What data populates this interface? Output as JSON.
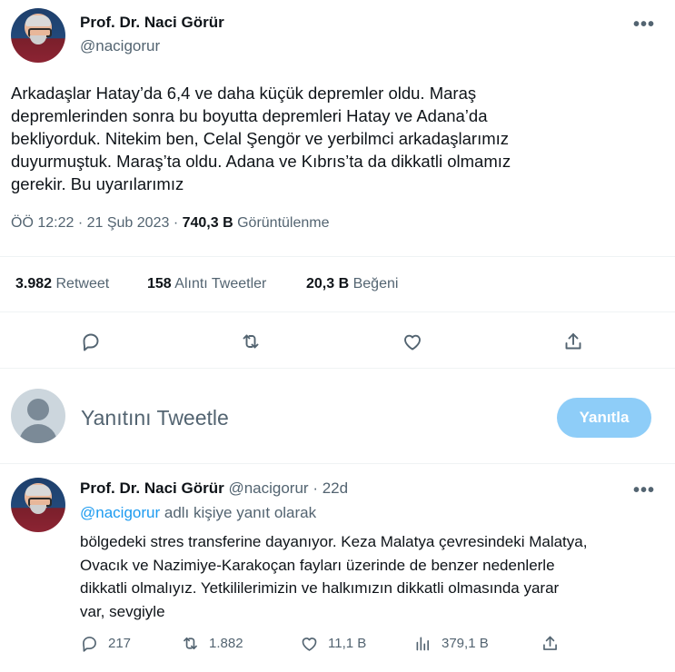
{
  "tweet": {
    "author_name": "Prof. Dr. Naci Görür",
    "author_handle": "@nacigorur",
    "more_label": "•••",
    "text_lines": [
      "Arkadaşlar Hatay’da 6,4 ve daha küçük depremler oldu. Maraş",
      "depremlerinden sonra bu boyutta depremleri Hatay ve Adana’da",
      "bekliyorduk. Nitekim ben, Celal Şengör ve yerbilmci arkadaşlarımız",
      "duyurmuştuk. Maraş’ta oldu. Adana ve Kıbrıs’ta da dikkatli olmamız",
      "gerekir. Bu uyarılarımız"
    ],
    "time": "ÖÖ 12:22",
    "date": "21 Şub 2023",
    "separator": "·",
    "views_count": "740,3 B",
    "views_label": "Görüntülenme"
  },
  "stats": {
    "retweets_count": "3.982",
    "retweets_label": "Retweet",
    "quotes_count": "158",
    "quotes_label": "Alıntı Tweetler",
    "likes_count": "20,3 B",
    "likes_label": "Beğeni"
  },
  "actions": [
    "reply-icon",
    "retweet-icon",
    "like-icon",
    "share-icon"
  ],
  "compose": {
    "placeholder": "Yanıtını Tweetle",
    "button_label": "Yanıtla",
    "button_color": "#8ecdf8"
  },
  "reply": {
    "author_name": "Prof. Dr. Naci Görür",
    "author_handle": "@nacigorur",
    "separator": "·",
    "age": "22d",
    "more_label": "•••",
    "replying_to_handle": "@nacigorur",
    "replying_to_suffix": "adlı kişiye yanıt olarak",
    "text_lines": [
      "bölgedeki stres transferine dayanıyor. Keza Malatya çevresindeki Malatya,",
      "Ovacık ve Nazimiye-Karakoçan fayları üzerinde de benzer nedenlerle",
      "dikkatli olmalıyız. Yetkililerimizin ve halkımızın dikkatli olmasında yarar",
      "var, sevgiyle"
    ],
    "replies": "217",
    "retweets": "1.882",
    "likes": "11,1 B",
    "views": "379,1 B"
  },
  "colors": {
    "accent": "#1d9bf0",
    "text": "#0f1419",
    "muted": "#536471",
    "divider": "#eff3f4"
  }
}
